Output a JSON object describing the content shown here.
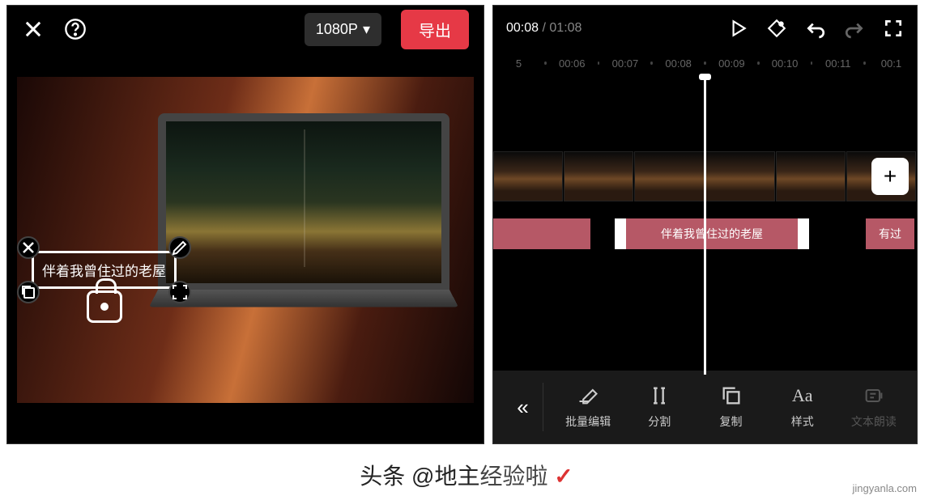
{
  "left": {
    "resolution": "1080P",
    "export_label": "导出",
    "caption_text": "伴着我曾住过的老屋"
  },
  "right": {
    "time_current": "00:08",
    "time_total": "01:08",
    "ruler": [
      "5",
      "00:06",
      "00:07",
      "00:08",
      "00:09",
      "00:10",
      "00:11",
      "00:1"
    ],
    "text_clip_1": "伴着我曾住过的老屋",
    "text_clip_2": "有过",
    "tools": {
      "back": "«",
      "batch": "批量编辑",
      "split": "分割",
      "copy": "复制",
      "style": "样式",
      "read": "文本朗读"
    }
  },
  "footer": {
    "wm1": "头条 @地主",
    "wm2": "经验啦",
    "url": "jingyanla.com"
  }
}
